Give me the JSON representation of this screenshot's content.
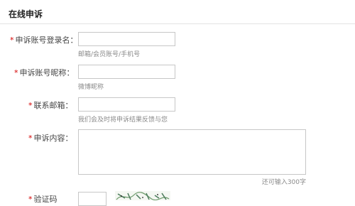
{
  "form": {
    "title": "在线申诉",
    "required_mark": "*",
    "fields": {
      "login_name": {
        "label": "申诉账号登录名：",
        "value": "",
        "hint": "邮箱/会员账号/手机号"
      },
      "nickname": {
        "label": "申诉账号昵称：",
        "value": "",
        "hint": "微博昵称"
      },
      "email": {
        "label": "联系邮箱：",
        "value": "",
        "hint": "我们会及时将申诉结果反馈与您"
      },
      "content": {
        "label": "申诉内容：",
        "value": "",
        "hint": "还可输入300字"
      },
      "captcha": {
        "label": "验证码",
        "value": ""
      }
    }
  },
  "colors": {
    "required_star": "#d40000",
    "hint_text": "#8a8a8a",
    "border": "#c7c7c7"
  }
}
